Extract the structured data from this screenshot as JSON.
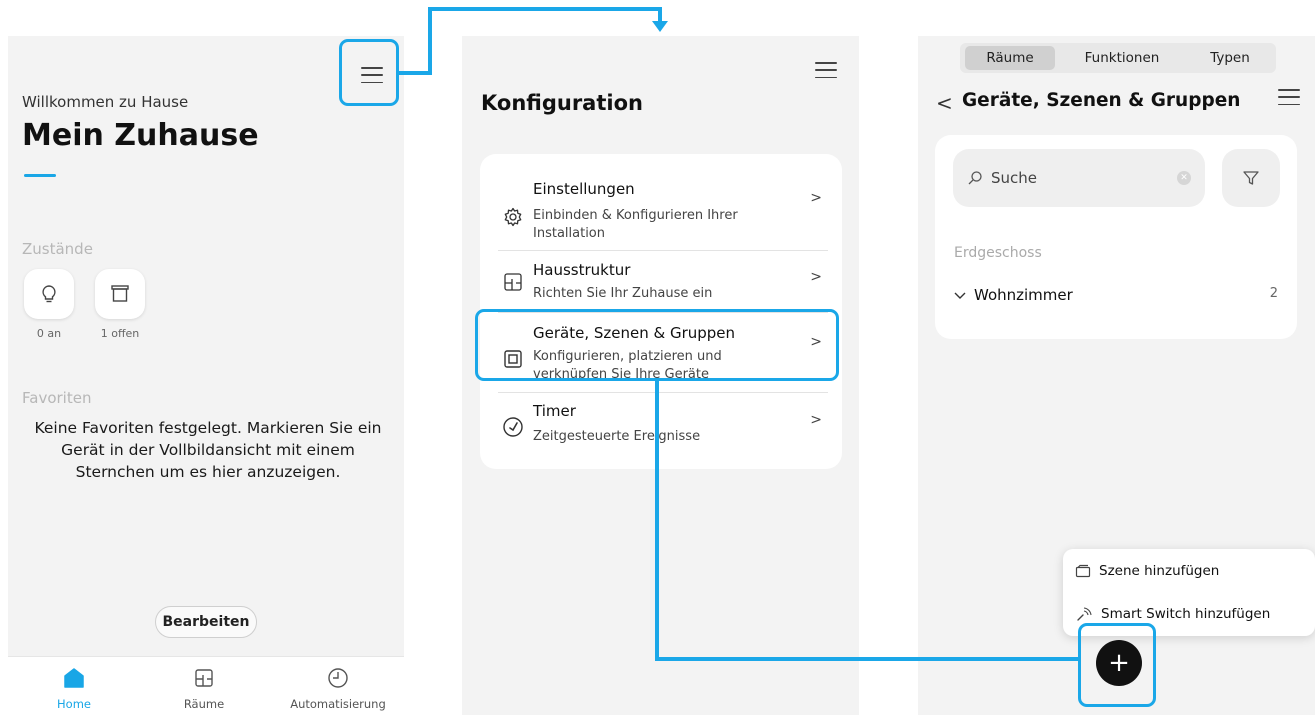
{
  "home": {
    "welcome": "Willkommen zu Hause",
    "title": "Mein Zuhause",
    "states_label": "Zustände",
    "states": [
      {
        "icon": "lightbulb-icon",
        "caption": "0 an"
      },
      {
        "icon": "blind-icon",
        "caption": "1 offen"
      }
    ],
    "favorites_label": "Favoriten",
    "favorites_empty": "Keine Favoriten festgelegt. Markieren Sie ein Gerät in der Vollbildansicht mit einem Sternchen um es hier anzuzeigen.",
    "edit_button": "Bearbeiten",
    "nav": [
      {
        "label": "Home",
        "icon": "home-icon",
        "active": true
      },
      {
        "label": "Räume",
        "icon": "rooms-icon",
        "active": false
      },
      {
        "label": "Automatisierung",
        "icon": "clock-icon",
        "active": false
      }
    ]
  },
  "config": {
    "title": "Konfiguration",
    "items": [
      {
        "title": "Einstellungen",
        "subtitle": "Einbinden & Konfigurieren Ihrer Installation",
        "icon": "gear-icon"
      },
      {
        "title": "Hausstruktur",
        "subtitle": "Richten Sie Ihr Zuhause ein",
        "icon": "floorplan-icon"
      },
      {
        "title": "Geräte, Szenen & Gruppen",
        "subtitle": "Konfigurieren, platzieren und verknüpfen Sie Ihre Geräte",
        "icon": "device-icon"
      },
      {
        "title": "Timer",
        "subtitle": "Zeitgesteuerte Ereignisse",
        "icon": "timer-icon"
      }
    ]
  },
  "devices": {
    "tabs": [
      "Räume",
      "Funktionen",
      "Typen"
    ],
    "title": "Geräte, Szenen & Gruppen",
    "search_placeholder": "Suche",
    "floor": "Erdgeschoss",
    "room": {
      "name": "Wohnzimmer",
      "count": "2"
    },
    "menu": [
      {
        "label": "Szene hinzufügen",
        "icon": "scene-icon"
      },
      {
        "label": "Smart Switch hinzufügen",
        "icon": "smart-switch-icon"
      }
    ],
    "fab": "+"
  },
  "colors": {
    "accent": "#1aa7e8",
    "background": "#f3f3f3"
  }
}
